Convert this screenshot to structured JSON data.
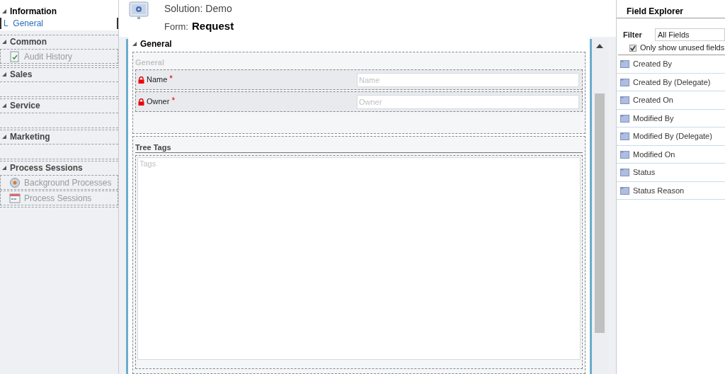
{
  "nav": {
    "sections": [
      {
        "title": "Information",
        "expanded": true,
        "items": [
          {
            "prefix": "L",
            "label": "General",
            "kind": "tab",
            "selected": true
          }
        ]
      },
      {
        "title": "Common",
        "expanded": true,
        "items": [
          {
            "label": "Audit History",
            "kind": "audit",
            "selected": false
          }
        ]
      },
      {
        "title": "Sales",
        "expanded": true
      },
      {
        "title": "Service",
        "expanded": true
      },
      {
        "title": "Marketing",
        "expanded": true
      },
      {
        "title": "Process Sessions",
        "expanded": true,
        "items": [
          {
            "label": "Background Processes",
            "kind": "background",
            "selected": false
          },
          {
            "label": "Process Sessions",
            "kind": "sessions",
            "selected": false
          }
        ]
      }
    ]
  },
  "header": {
    "solution": "Solution: Demo",
    "form_label": "Form:",
    "form_name": "Request"
  },
  "tab": {
    "title": "General",
    "expanded": true,
    "sections": [
      {
        "kind": "fields",
        "title": "General",
        "fields": [
          {
            "label": "Name",
            "placeholder": "Name",
            "locked": true,
            "required_mark": "*"
          },
          {
            "label": "Owner",
            "placeholder": "Owner",
            "locked": true,
            "required_mark": "*"
          }
        ]
      },
      {
        "kind": "textarea",
        "title": "Tree Tags",
        "placeholder": "Tags"
      }
    ]
  },
  "field_explorer": {
    "title": "Field Explorer",
    "filter_label": "Filter",
    "filter_value": "All Fields",
    "unused_only": {
      "label": "Only show unused fields",
      "checked": true
    },
    "fields": [
      "Created By",
      "Created By (Delegate)",
      "Created On",
      "Modified By",
      "Modified By (Delegate)",
      "Modified On",
      "Status",
      "Status Reason"
    ]
  }
}
